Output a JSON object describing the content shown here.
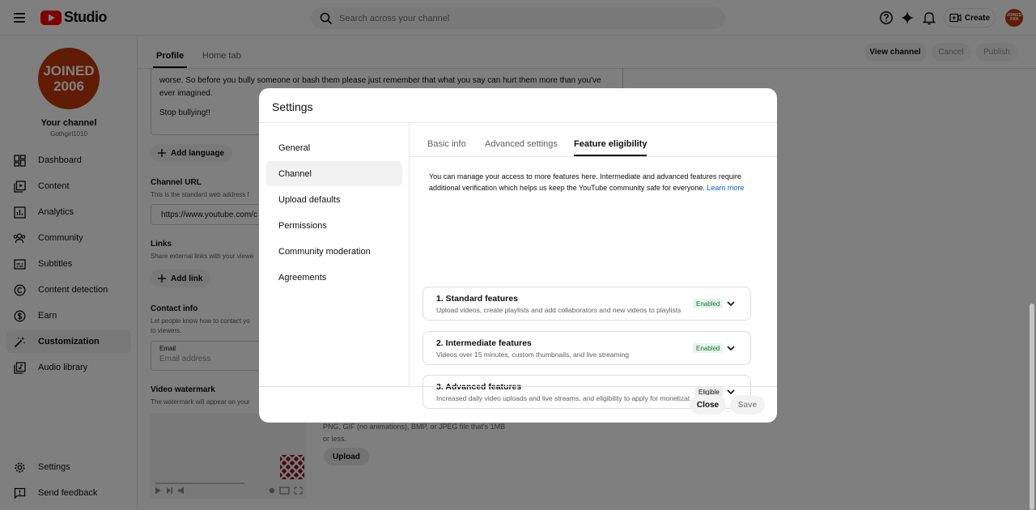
{
  "app": {
    "name": "Studio"
  },
  "search": {
    "placeholder": "Search across your channel"
  },
  "top": {
    "create_label": "Create",
    "avatar_text": "JOINED 2006"
  },
  "channel": {
    "avatar_line1": "JOINED",
    "avatar_line2": "2006",
    "title": "Your channel",
    "handle": "Gothgirl1010"
  },
  "sidebar": {
    "items": [
      {
        "label": "Dashboard",
        "icon": "dashboard-icon"
      },
      {
        "label": "Content",
        "icon": "content-icon"
      },
      {
        "label": "Analytics",
        "icon": "analytics-icon"
      },
      {
        "label": "Community",
        "icon": "community-icon"
      },
      {
        "label": "Subtitles",
        "icon": "subtitles-icon"
      },
      {
        "label": "Content detection",
        "icon": "copyright-icon"
      },
      {
        "label": "Earn",
        "icon": "dollar-icon"
      },
      {
        "label": "Customization",
        "icon": "magic-wand-icon",
        "active": true
      },
      {
        "label": "Audio library",
        "icon": "audio-library-icon"
      }
    ],
    "settings_label": "Settings",
    "feedback_label": "Send feedback"
  },
  "main": {
    "tabs": [
      "Profile",
      "Home tab"
    ],
    "header_buttons": {
      "view_channel": "View channel",
      "cancel": "Cancel",
      "publish": "Publish"
    },
    "description_lines": [
      "worse. So before you bully someone or bash them please just remember that what you say can hurt them more than you've",
      "ever imagined.",
      "Stop bullying!!"
    ],
    "add_language": "Add language",
    "channel_url": {
      "title": "Channel URL",
      "sub": "This is the standard web address f",
      "value": "https://www.youtube.com/c"
    },
    "links": {
      "title": "Links",
      "sub": "Share external links with your viewe",
      "add_link": "Add link"
    },
    "contact": {
      "title": "Contact info",
      "sub1": "Let people know how to contact yo",
      "sub2": "to viewers.",
      "email_label": "Email",
      "email_placeholder": "Email address"
    },
    "watermark": {
      "title": "Video watermark",
      "sub": "The watermark will appear on your",
      "note1": "PNG, GIF (no animations), BMP, or JPEG file that's 1MB",
      "note2": "or less.",
      "upload": "Upload"
    }
  },
  "dialog": {
    "title": "Settings",
    "nav": [
      "General",
      "Channel",
      "Upload defaults",
      "Permissions",
      "Community moderation",
      "Agreements"
    ],
    "active_nav": "Channel",
    "tabs": [
      "Basic info",
      "Advanced settings",
      "Feature eligibility"
    ],
    "active_tab": "Feature eligibility",
    "intro_line1": "You can manage your access to more features here. Intermediate and advanced features require",
    "intro_line2": "additional verification which helps us keep the YouTube community safe for everyone.",
    "learn_more": "Learn more",
    "features": [
      {
        "title": "1. Standard features",
        "desc": "Upload videos, create playlists and add collaborators and new videos to playlists",
        "status": "Enabled"
      },
      {
        "title": "2. Intermediate features",
        "desc": "Videos over 15 minutes, custom thumbnails, and live streaming",
        "status": "Enabled"
      },
      {
        "title": "3. Advanced features",
        "desc": "Increased daily video uploads and live streams, and eligibility to apply for monetization",
        "status": "Eligible"
      }
    ],
    "close_label": "Close",
    "save_label": "Save"
  },
  "colors": {
    "brand_red": "#ff0000",
    "avatar": "#c0390b",
    "link": "#065fd4",
    "enabled_bg": "#e6f4ea",
    "enabled_text": "#137333"
  }
}
